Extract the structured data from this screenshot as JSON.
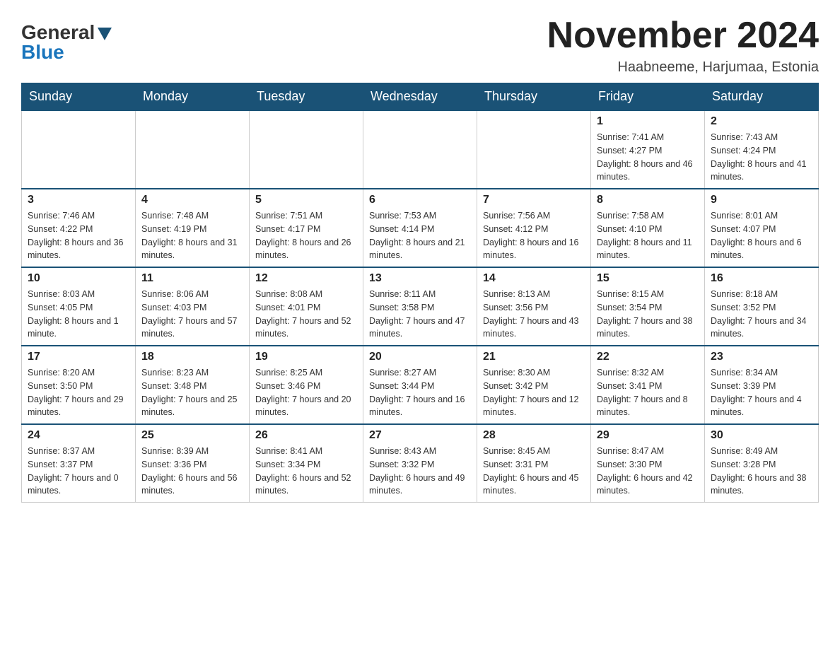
{
  "header": {
    "logo_general": "General",
    "logo_blue": "Blue",
    "month_title": "November 2024",
    "location": "Haabneeme, Harjumaa, Estonia"
  },
  "weekdays": [
    "Sunday",
    "Monday",
    "Tuesday",
    "Wednesday",
    "Thursday",
    "Friday",
    "Saturday"
  ],
  "weeks": [
    [
      {
        "day": "",
        "info": ""
      },
      {
        "day": "",
        "info": ""
      },
      {
        "day": "",
        "info": ""
      },
      {
        "day": "",
        "info": ""
      },
      {
        "day": "",
        "info": ""
      },
      {
        "day": "1",
        "info": "Sunrise: 7:41 AM\nSunset: 4:27 PM\nDaylight: 8 hours and 46 minutes."
      },
      {
        "day": "2",
        "info": "Sunrise: 7:43 AM\nSunset: 4:24 PM\nDaylight: 8 hours and 41 minutes."
      }
    ],
    [
      {
        "day": "3",
        "info": "Sunrise: 7:46 AM\nSunset: 4:22 PM\nDaylight: 8 hours and 36 minutes."
      },
      {
        "day": "4",
        "info": "Sunrise: 7:48 AM\nSunset: 4:19 PM\nDaylight: 8 hours and 31 minutes."
      },
      {
        "day": "5",
        "info": "Sunrise: 7:51 AM\nSunset: 4:17 PM\nDaylight: 8 hours and 26 minutes."
      },
      {
        "day": "6",
        "info": "Sunrise: 7:53 AM\nSunset: 4:14 PM\nDaylight: 8 hours and 21 minutes."
      },
      {
        "day": "7",
        "info": "Sunrise: 7:56 AM\nSunset: 4:12 PM\nDaylight: 8 hours and 16 minutes."
      },
      {
        "day": "8",
        "info": "Sunrise: 7:58 AM\nSunset: 4:10 PM\nDaylight: 8 hours and 11 minutes."
      },
      {
        "day": "9",
        "info": "Sunrise: 8:01 AM\nSunset: 4:07 PM\nDaylight: 8 hours and 6 minutes."
      }
    ],
    [
      {
        "day": "10",
        "info": "Sunrise: 8:03 AM\nSunset: 4:05 PM\nDaylight: 8 hours and 1 minute."
      },
      {
        "day": "11",
        "info": "Sunrise: 8:06 AM\nSunset: 4:03 PM\nDaylight: 7 hours and 57 minutes."
      },
      {
        "day": "12",
        "info": "Sunrise: 8:08 AM\nSunset: 4:01 PM\nDaylight: 7 hours and 52 minutes."
      },
      {
        "day": "13",
        "info": "Sunrise: 8:11 AM\nSunset: 3:58 PM\nDaylight: 7 hours and 47 minutes."
      },
      {
        "day": "14",
        "info": "Sunrise: 8:13 AM\nSunset: 3:56 PM\nDaylight: 7 hours and 43 minutes."
      },
      {
        "day": "15",
        "info": "Sunrise: 8:15 AM\nSunset: 3:54 PM\nDaylight: 7 hours and 38 minutes."
      },
      {
        "day": "16",
        "info": "Sunrise: 8:18 AM\nSunset: 3:52 PM\nDaylight: 7 hours and 34 minutes."
      }
    ],
    [
      {
        "day": "17",
        "info": "Sunrise: 8:20 AM\nSunset: 3:50 PM\nDaylight: 7 hours and 29 minutes."
      },
      {
        "day": "18",
        "info": "Sunrise: 8:23 AM\nSunset: 3:48 PM\nDaylight: 7 hours and 25 minutes."
      },
      {
        "day": "19",
        "info": "Sunrise: 8:25 AM\nSunset: 3:46 PM\nDaylight: 7 hours and 20 minutes."
      },
      {
        "day": "20",
        "info": "Sunrise: 8:27 AM\nSunset: 3:44 PM\nDaylight: 7 hours and 16 minutes."
      },
      {
        "day": "21",
        "info": "Sunrise: 8:30 AM\nSunset: 3:42 PM\nDaylight: 7 hours and 12 minutes."
      },
      {
        "day": "22",
        "info": "Sunrise: 8:32 AM\nSunset: 3:41 PM\nDaylight: 7 hours and 8 minutes."
      },
      {
        "day": "23",
        "info": "Sunrise: 8:34 AM\nSunset: 3:39 PM\nDaylight: 7 hours and 4 minutes."
      }
    ],
    [
      {
        "day": "24",
        "info": "Sunrise: 8:37 AM\nSunset: 3:37 PM\nDaylight: 7 hours and 0 minutes."
      },
      {
        "day": "25",
        "info": "Sunrise: 8:39 AM\nSunset: 3:36 PM\nDaylight: 6 hours and 56 minutes."
      },
      {
        "day": "26",
        "info": "Sunrise: 8:41 AM\nSunset: 3:34 PM\nDaylight: 6 hours and 52 minutes."
      },
      {
        "day": "27",
        "info": "Sunrise: 8:43 AM\nSunset: 3:32 PM\nDaylight: 6 hours and 49 minutes."
      },
      {
        "day": "28",
        "info": "Sunrise: 8:45 AM\nSunset: 3:31 PM\nDaylight: 6 hours and 45 minutes."
      },
      {
        "day": "29",
        "info": "Sunrise: 8:47 AM\nSunset: 3:30 PM\nDaylight: 6 hours and 42 minutes."
      },
      {
        "day": "30",
        "info": "Sunrise: 8:49 AM\nSunset: 3:28 PM\nDaylight: 6 hours and 38 minutes."
      }
    ]
  ]
}
